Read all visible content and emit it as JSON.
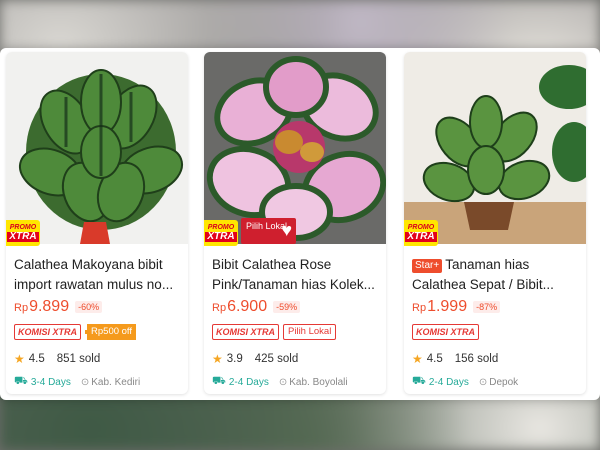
{
  "products": [
    {
      "badges": {
        "promo_top": "PROMO",
        "promo_bottom": "XTRA"
      },
      "title": "Calathea Makoyana bibit import rawatan mulus no...",
      "currency": "Rp",
      "price": "9.899",
      "discount": "-60%",
      "tag_komisi": "KOMISI XTRA",
      "tag_extra": "Rp500 off",
      "rating": "4.5",
      "sold": "851 sold",
      "shipping": "3-4 Days",
      "location": "Kab. Kediri"
    },
    {
      "badges": {
        "promo_top": "PROMO",
        "promo_bottom": "XTRA",
        "lokal": "Pilih Lokal"
      },
      "title": "Bibit Calathea Rose Pink/Tanaman hias Kolek...",
      "currency": "Rp",
      "price": "6.900",
      "discount": "-59%",
      "tag_komisi": "KOMISI XTRA",
      "tag_extra": "Pilih Lokal",
      "rating": "3.9",
      "sold": "425 sold",
      "shipping": "2-4 Days",
      "location": "Kab. Boyolali"
    },
    {
      "badges": {
        "promo_top": "PROMO",
        "promo_bottom": "XTRA",
        "star": "Star+"
      },
      "title": "Tanaman hias Calathea Sepat / Bibit...",
      "currency": "Rp",
      "price": "1.999",
      "discount": "-87%",
      "tag_komisi": "KOMISI XTRA",
      "rating": "4.5",
      "sold": "156 sold",
      "shipping": "2-4 Days",
      "location": "Depok"
    }
  ],
  "icons": {
    "rating": "star-icon",
    "shipping": "truck-icon",
    "location": "pin-icon"
  },
  "colors": {
    "price": "#ee4d2d",
    "shipping": "#26aa99",
    "promo": "#ffe600",
    "rating_star": "#f5a623"
  }
}
